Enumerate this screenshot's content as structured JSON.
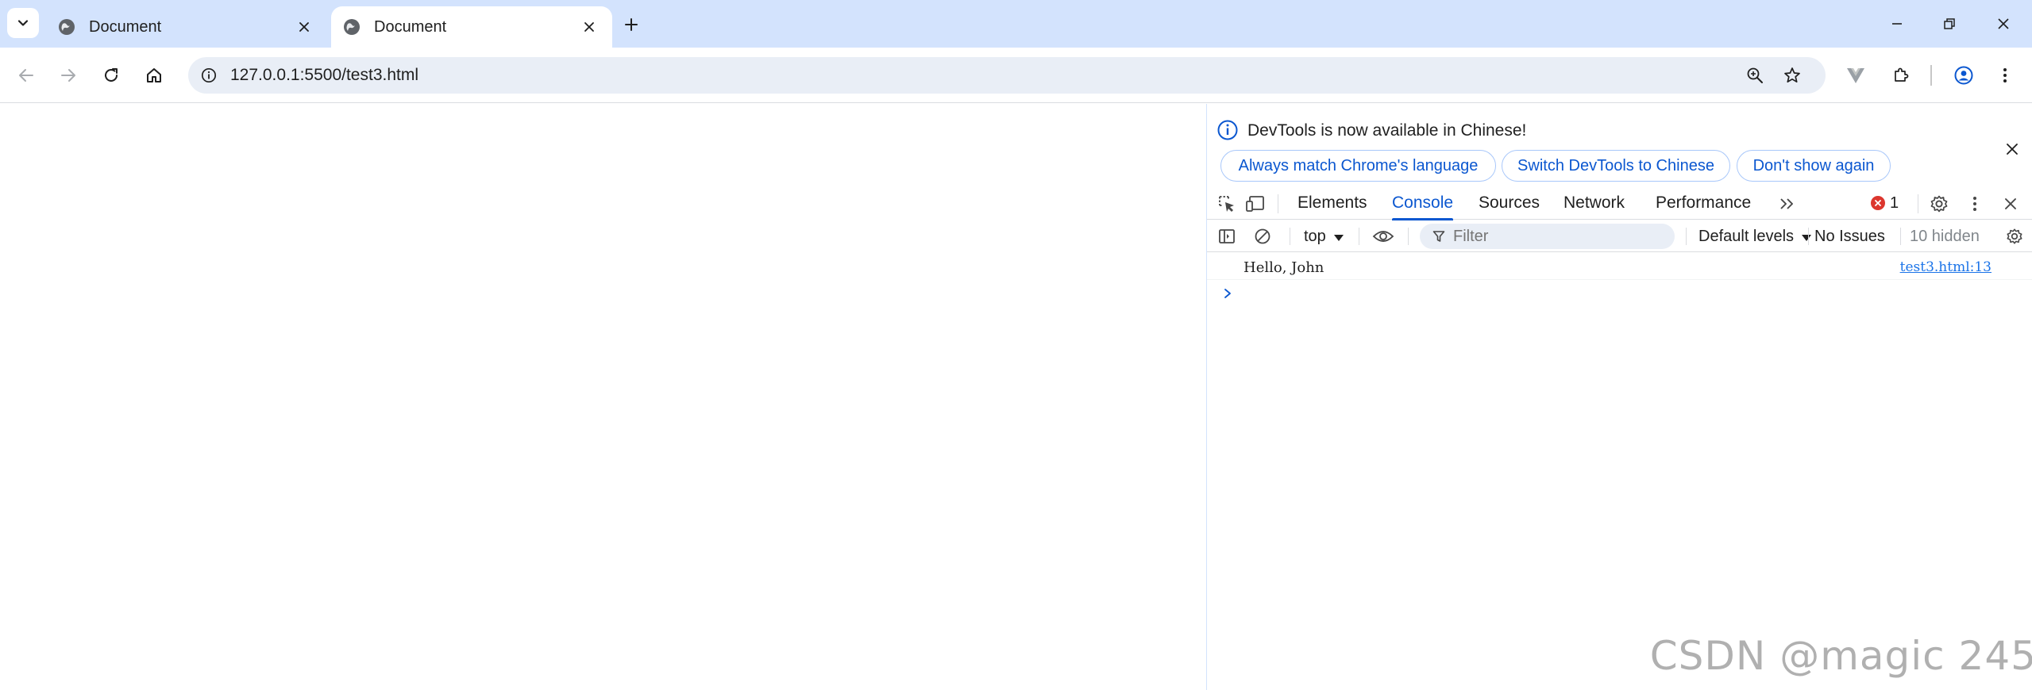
{
  "browser": {
    "tabs": [
      {
        "title": "Document",
        "active": false
      },
      {
        "title": "Document",
        "active": true
      }
    ],
    "url": "127.0.0.1:5500/test3.html"
  },
  "devtools": {
    "infobar": {
      "message": "DevTools is now available in Chinese!",
      "buttons": [
        "Always match Chrome's language",
        "Switch DevTools to Chinese",
        "Don't show again"
      ]
    },
    "tabs": [
      "Elements",
      "Console",
      "Sources",
      "Network",
      "Performance"
    ],
    "active_tab": "Console",
    "error_count": "1",
    "console_toolbar": {
      "context": "top",
      "filter_placeholder": "Filter",
      "levels": "Default levels",
      "issues": "No Issues",
      "hidden": "10 hidden"
    },
    "messages": [
      {
        "text": "Hello, John",
        "source": "test3.html:13"
      }
    ]
  },
  "watermark": "CSDN @magic 245",
  "colors": {
    "tabstrip_bg": "#d3e3fd",
    "accent": "#0b57d0",
    "omnibox_bg": "#e9eef6",
    "error": "#dc362e"
  }
}
